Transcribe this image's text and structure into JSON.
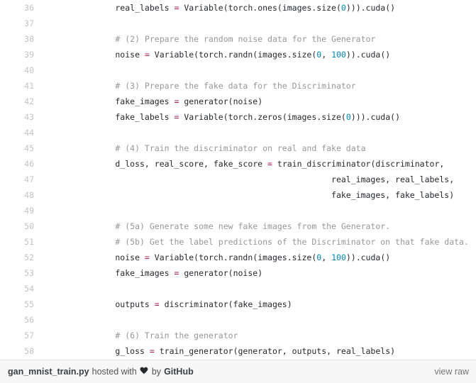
{
  "gist": {
    "filename": "gan_mnist_train.py",
    "hosted_with_text": "hosted with",
    "heart_icon": "heart-icon",
    "by_text": "by",
    "provider": "GitHub",
    "view_raw_label": "view raw"
  },
  "colors": {
    "background": "#ffffff",
    "footer_background": "#f7f7f7",
    "footer_border": "#e1e4e8",
    "line_number": "#c0c4c8",
    "code_text": "#24292e",
    "comment": "#969896",
    "operator": "#a71d5d",
    "number": "#0086b3"
  },
  "code": {
    "first_line_number": 36,
    "lines": [
      {
        "n": "36",
        "tokens": [
          {
            "t": "        real_labels ",
            "c": "plain"
          },
          {
            "t": "=",
            "c": "op"
          },
          {
            "t": " Variable(torch.ones(images.size(",
            "c": "plain"
          },
          {
            "t": "0",
            "c": "num"
          },
          {
            "t": "))).cuda()",
            "c": "plain"
          }
        ]
      },
      {
        "n": "37",
        "tokens": []
      },
      {
        "n": "38",
        "tokens": [
          {
            "t": "        # (2) Prepare the random noise data for the Generator",
            "c": "comment"
          }
        ]
      },
      {
        "n": "39",
        "tokens": [
          {
            "t": "        noise ",
            "c": "plain"
          },
          {
            "t": "=",
            "c": "op"
          },
          {
            "t": " Variable(torch.randn(images.size(",
            "c": "plain"
          },
          {
            "t": "0",
            "c": "num"
          },
          {
            "t": ", ",
            "c": "plain"
          },
          {
            "t": "100",
            "c": "num"
          },
          {
            "t": ")).cuda()",
            "c": "plain"
          }
        ]
      },
      {
        "n": "40",
        "tokens": []
      },
      {
        "n": "41",
        "tokens": [
          {
            "t": "        # (3) Prepare the fake data for the Discriminator",
            "c": "comment"
          }
        ]
      },
      {
        "n": "42",
        "tokens": [
          {
            "t": "        fake_images ",
            "c": "plain"
          },
          {
            "t": "=",
            "c": "op"
          },
          {
            "t": " generator(noise)",
            "c": "plain"
          }
        ]
      },
      {
        "n": "43",
        "tokens": [
          {
            "t": "        fake_labels ",
            "c": "plain"
          },
          {
            "t": "=",
            "c": "op"
          },
          {
            "t": " Variable(torch.zeros(images.size(",
            "c": "plain"
          },
          {
            "t": "0",
            "c": "num"
          },
          {
            "t": "))).cuda()",
            "c": "plain"
          }
        ]
      },
      {
        "n": "44",
        "tokens": []
      },
      {
        "n": "45",
        "tokens": [
          {
            "t": "        # (4) Train the discriminator on real and fake data",
            "c": "comment"
          }
        ]
      },
      {
        "n": "46",
        "tokens": [
          {
            "t": "        d_loss, real_score, fake_score ",
            "c": "plain"
          },
          {
            "t": "=",
            "c": "op"
          },
          {
            "t": " train_discriminator(discriminator,",
            "c": "plain"
          }
        ]
      },
      {
        "n": "47",
        "tokens": [
          {
            "t": "                                                    real_images, real_labels,",
            "c": "plain"
          }
        ]
      },
      {
        "n": "48",
        "tokens": [
          {
            "t": "                                                    fake_images, fake_labels)",
            "c": "plain"
          }
        ]
      },
      {
        "n": "49",
        "tokens": []
      },
      {
        "n": "50",
        "tokens": [
          {
            "t": "        # (5a) Generate some new fake images from the Generator.",
            "c": "comment"
          }
        ]
      },
      {
        "n": "51",
        "tokens": [
          {
            "t": "        # (5b) Get the label predictions of the Discriminator on that fake data.",
            "c": "comment"
          }
        ]
      },
      {
        "n": "52",
        "tokens": [
          {
            "t": "        noise ",
            "c": "plain"
          },
          {
            "t": "=",
            "c": "op"
          },
          {
            "t": " Variable(torch.randn(images.size(",
            "c": "plain"
          },
          {
            "t": "0",
            "c": "num"
          },
          {
            "t": ", ",
            "c": "plain"
          },
          {
            "t": "100",
            "c": "num"
          },
          {
            "t": ")).cuda()",
            "c": "plain"
          }
        ]
      },
      {
        "n": "53",
        "tokens": [
          {
            "t": "        fake_images ",
            "c": "plain"
          },
          {
            "t": "=",
            "c": "op"
          },
          {
            "t": " generator(noise)",
            "c": "plain"
          }
        ]
      },
      {
        "n": "54",
        "tokens": []
      },
      {
        "n": "55",
        "tokens": [
          {
            "t": "        outputs ",
            "c": "plain"
          },
          {
            "t": "=",
            "c": "op"
          },
          {
            "t": " discriminator(fake_images)",
            "c": "plain"
          }
        ]
      },
      {
        "n": "56",
        "tokens": []
      },
      {
        "n": "57",
        "tokens": [
          {
            "t": "        # (6) Train the generator",
            "c": "comment"
          }
        ]
      },
      {
        "n": "58",
        "tokens": [
          {
            "t": "        g_loss ",
            "c": "plain"
          },
          {
            "t": "=",
            "c": "op"
          },
          {
            "t": " train_generator(generator, outputs, real_labels)",
            "c": "plain"
          }
        ]
      }
    ]
  }
}
